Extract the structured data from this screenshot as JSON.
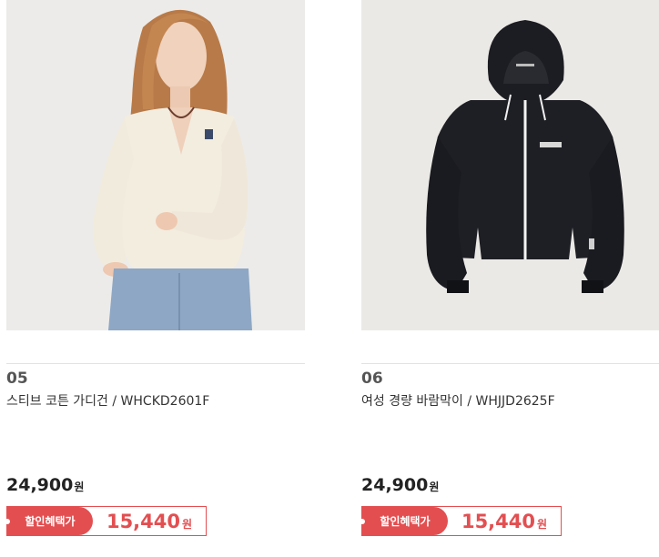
{
  "products": [
    {
      "number": "05",
      "name": "스티브 코튼 가디건 / WHCKD2601F",
      "price": "24,900",
      "price_unit": "원",
      "sale_label": "할인혜택가",
      "sale_price": "15,440",
      "sale_unit": "원",
      "image": "model-white-cardigan-jeans"
    },
    {
      "number": "06",
      "name": "여성 경량 바람막이 / WHJJD2625F",
      "price": "24,900",
      "price_unit": "원",
      "sale_label": "할인혜택가",
      "sale_price": "15,440",
      "sale_unit": "원",
      "image": "black-hooded-windbreaker"
    }
  ],
  "colors": {
    "accent": "#e34f51",
    "image_bg": "#ecebe9"
  }
}
